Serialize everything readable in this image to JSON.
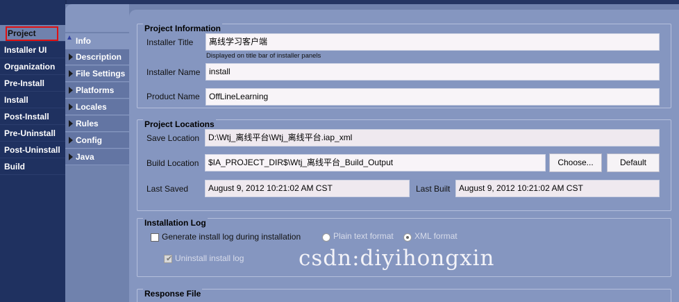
{
  "left_nav": {
    "items": [
      {
        "label": "Project",
        "selected": true
      },
      {
        "label": "Installer UI"
      },
      {
        "label": "Organization"
      },
      {
        "label": "Pre-Install"
      },
      {
        "label": "Install"
      },
      {
        "label": "Post-Install"
      },
      {
        "label": "Pre-Uninstall"
      },
      {
        "label": "Post-Uninstall"
      },
      {
        "label": "Build"
      }
    ]
  },
  "sub_nav": {
    "items": [
      {
        "label": "Info",
        "selected": true
      },
      {
        "label": "Description"
      },
      {
        "label": "File Settings"
      },
      {
        "label": "Platforms"
      },
      {
        "label": "Locales"
      },
      {
        "label": "Rules"
      },
      {
        "label": "Config"
      },
      {
        "label": "Java"
      }
    ]
  },
  "project_information": {
    "title": "Project Information",
    "installer_title_label": "Installer Title",
    "installer_title_value": "离线学习客户端",
    "installer_title_hint": "Displayed on title bar of installer panels",
    "installer_name_label": "Installer Name",
    "installer_name_value": "install",
    "product_name_label": "Product Name",
    "product_name_value": "OffLineLearning"
  },
  "project_locations": {
    "title": "Project Locations",
    "save_location_label": "Save Location",
    "save_location_value": "D:\\Wtj_离线平台\\Wtj_离线平台.iap_xml",
    "build_location_label": "Build Location",
    "build_location_value": "$IA_PROJECT_DIR$\\Wtj_离线平台_Build_Output",
    "choose_button": "Choose...",
    "default_button": "Default",
    "last_saved_label": "Last Saved",
    "last_saved_value": "August 9, 2012 10:21:02 AM CST",
    "last_built_label": "Last Built",
    "last_built_value": "August 9, 2012 10:21:02 AM CST"
  },
  "installation_log": {
    "title": "Installation Log",
    "generate_log_label": "Generate install log during installation",
    "plain_text_label": "Plain text format",
    "xml_label": "XML format",
    "uninstall_log_label": "Uninstall install log"
  },
  "response_file": {
    "title": "Response File"
  },
  "watermark": "csdn:diyihongxin",
  "colors": {
    "nav_bg": "#1f3160",
    "panel_bg": "#8596c0",
    "tab_bg": "#6375a3",
    "highlight_border": "#e01010"
  }
}
